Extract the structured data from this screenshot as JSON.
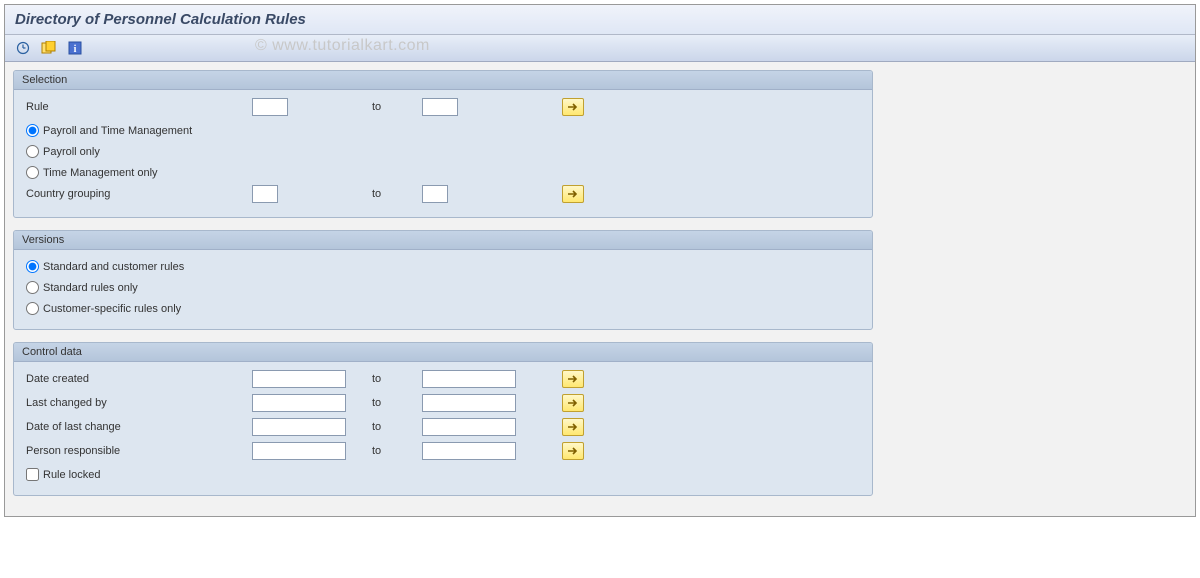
{
  "title": "Directory of Personnel Calculation Rules",
  "watermark": "© www.tutorialkart.com",
  "groups": {
    "selection": {
      "title": "Selection",
      "rule_label": "Rule",
      "to_label": "to",
      "radio_payroll_time": "Payroll and Time Management",
      "radio_payroll_only": "Payroll only",
      "radio_time_only": "Time Management only",
      "country_grouping_label": "Country grouping"
    },
    "versions": {
      "title": "Versions",
      "radio_std_cust": "Standard and customer rules",
      "radio_std_only": "Standard rules only",
      "radio_cust_only": "Customer-specific rules only"
    },
    "control": {
      "title": "Control data",
      "date_created": "Date created",
      "last_changed_by": "Last changed by",
      "date_last_change": "Date of last change",
      "person_responsible": "Person responsible",
      "rule_locked": "Rule locked",
      "to_label": "to"
    }
  }
}
